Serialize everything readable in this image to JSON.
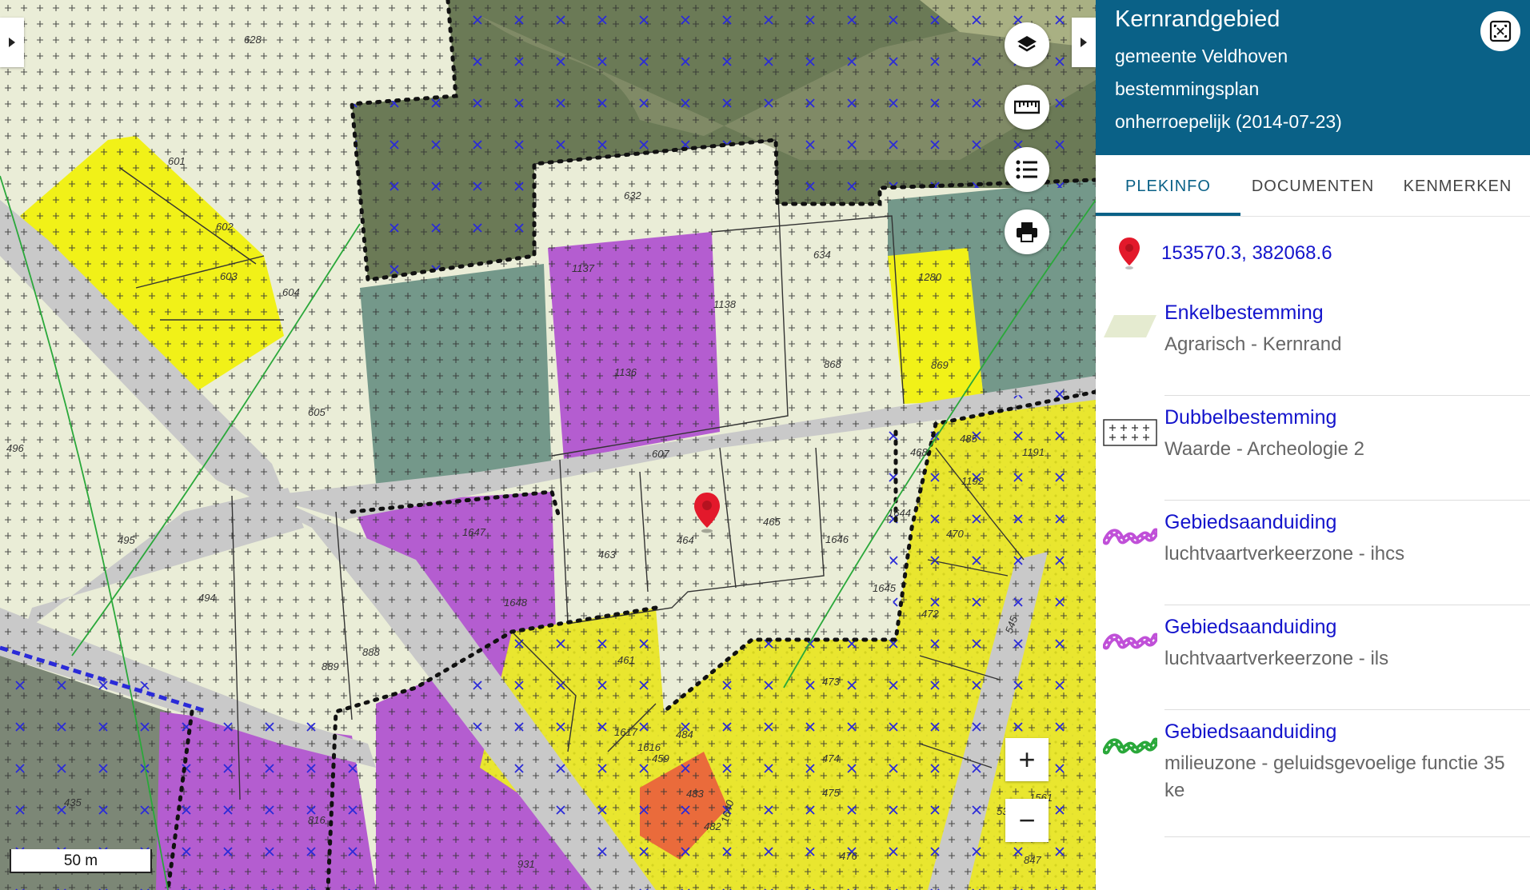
{
  "map": {
    "parcel_numbers": [
      "628",
      "601",
      "602",
      "603",
      "604",
      "605",
      "496",
      "495",
      "494",
      "889",
      "888",
      "435",
      "816",
      "931",
      "632",
      "634",
      "1137",
      "1138",
      "1136",
      "1280",
      "868",
      "869",
      "607",
      "1647",
      "1648",
      "463",
      "464",
      "465",
      "1646",
      "1644",
      "1645",
      "468",
      "485",
      "1191",
      "1192",
      "470",
      "472",
      "473",
      "474",
      "475",
      "476",
      "461",
      "1617",
      "1616",
      "459",
      "484",
      "483",
      "482",
      "1640",
      "1562",
      "1561",
      "536",
      "847",
      "545"
    ],
    "zoom_in_label": "+",
    "zoom_out_label": "−",
    "scale_label": "50 m"
  },
  "panel": {
    "title": "Kernrandgebied",
    "municipality": "gemeente Veldhoven",
    "plan_type": "bestemmingsplan",
    "status": "onherroepelijk (2014-07-23)",
    "tabs": [
      "PLEKINFO",
      "DOCUMENTEN",
      "KENMERKEN"
    ],
    "coordinates": "153570.3, 382068.6",
    "items": [
      {
        "title": "Enkelbestemming",
        "subtitle": "Agrarisch - Kernrand",
        "symbol": "agrarisch-icon"
      },
      {
        "title": "Dubbelbestemming",
        "subtitle": "Waarde - Archeologie 2",
        "symbol": "archeologie-icon"
      },
      {
        "title": "Gebiedsaanduiding",
        "subtitle": "luchtvaartverkeerzone - ihcs",
        "symbol": "zone-purple-icon"
      },
      {
        "title": "Gebiedsaanduiding",
        "subtitle": "luchtvaartverkeerzone - ils",
        "symbol": "zone-purple-icon"
      },
      {
        "title": "Gebiedsaanduiding",
        "subtitle": "milieuzone - geluidsgevoelige functie 35 ke",
        "symbol": "zone-green-icon"
      }
    ]
  },
  "colors": {
    "header": "#0a6187",
    "link": "#1414cc",
    "agrarisch": "#ecefd9",
    "wonen": "#ecec3a",
    "bedrijf": "#b45dd0",
    "groen": "#74988a",
    "weg": "#c9c9c9",
    "marker": "#e3192b"
  }
}
